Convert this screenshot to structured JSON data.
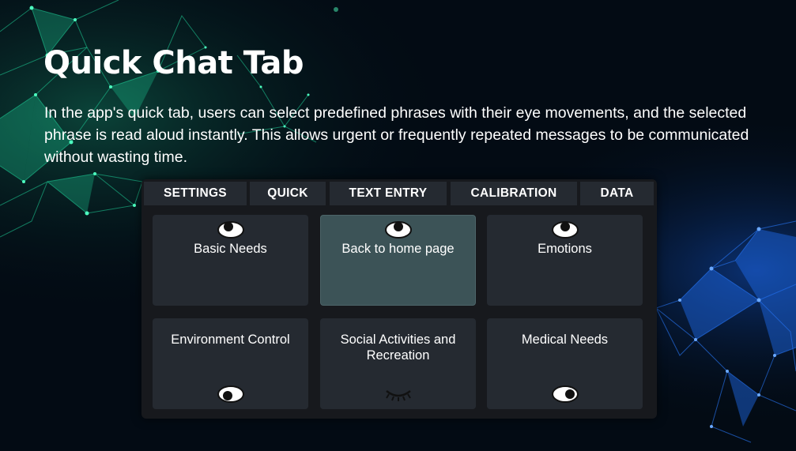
{
  "slide": {
    "title": "Quick Chat Tab",
    "description": "In the app's quick tab, users can select predefined phrases with their eye movements, and the selected phrase is read aloud instantly. This allows urgent or frequently repeated messages to be communicated without wasting time."
  },
  "app": {
    "tabs": [
      {
        "label": "SETTINGS"
      },
      {
        "label": "QUICK"
      },
      {
        "label": "TEXT ENTRY"
      },
      {
        "label": "CALIBRATION"
      },
      {
        "label": "DATA"
      }
    ],
    "cards": [
      {
        "label": "Basic Needs",
        "icon": "eye-looking-up-icon"
      },
      {
        "label": "Back to home page",
        "icon": "eye-looking-up-icon",
        "selected": true
      },
      {
        "label": "Emotions",
        "icon": "eye-looking-up-icon"
      },
      {
        "label": "Environment Control",
        "icon": "eye-looking-down-icon"
      },
      {
        "label": "Social Activities and Recreation",
        "icon": "closed-eye-icon"
      },
      {
        "label": "Medical Needs",
        "icon": "eye-looking-right-icon"
      }
    ]
  },
  "colors": {
    "background": "#030b14",
    "panel": "#17191d",
    "tab": "#252a31",
    "card": "#252a31",
    "card_selected": "#3c5357",
    "network_green": "#1fd39a",
    "network_blue": "#1e6cf0"
  }
}
